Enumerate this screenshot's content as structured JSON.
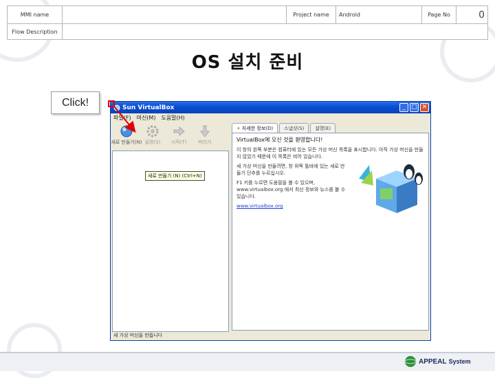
{
  "header": {
    "mmi_label": "MMI name",
    "mmi_value": "",
    "project_label": "Project name",
    "project_value": "Android",
    "pageno_label": "Page No",
    "pageno_value": "0",
    "flow_label": "Flow Description",
    "flow_value": ""
  },
  "title": "OS 설치 준비",
  "callout": "Click!",
  "window": {
    "title": "Sun VirtualBox",
    "menu": [
      "파일(F)",
      "머신(M)",
      "도움말(H)"
    ],
    "toolbar": [
      {
        "label": "새로 만들기(N)",
        "icon": "new-icon"
      },
      {
        "label": "설정(S)",
        "icon": "settings-icon"
      },
      {
        "label": "시작(T)",
        "icon": "start-icon"
      },
      {
        "label": "버리기",
        "icon": "discard-icon"
      }
    ],
    "tooltip": "새로 만들기 (N) (Ctrl+N)",
    "tabs": [
      "자세한 정보(D)",
      "스냅샷(S)",
      "설명(E)"
    ],
    "welcome_head": "VirtualBox에 오신 것을 환영합니다!",
    "paragraphs": [
      "이 창의 왼쪽 부분은 컴퓨터에 있는 모든 가상 머신 목록을 표시합니다. 아직 가상 머신을 만들지 않았기 때문에 이 목록은 비어 있습니다.",
      "새 가상 머신을 만들려면, 창 위쪽 툴바에 있는 새로 만들기 단추를 누르십시오.",
      "F1 키를 누르면 도움말을 볼 수 있으며, www.virtualbox.org 에서 최신 정보와 뉴스를 볼 수 있습니다."
    ],
    "link": "www.virtualbox.org",
    "status": "새 가상 머신을 만듭니다"
  },
  "footer": {
    "brand": "APPEAL System",
    "brand_main": "APPEAL",
    "brand_sub": "System"
  },
  "colors": {
    "titlebar": "#0a4fd4",
    "highlight": "#e00000",
    "link": "#1c3fd6"
  }
}
